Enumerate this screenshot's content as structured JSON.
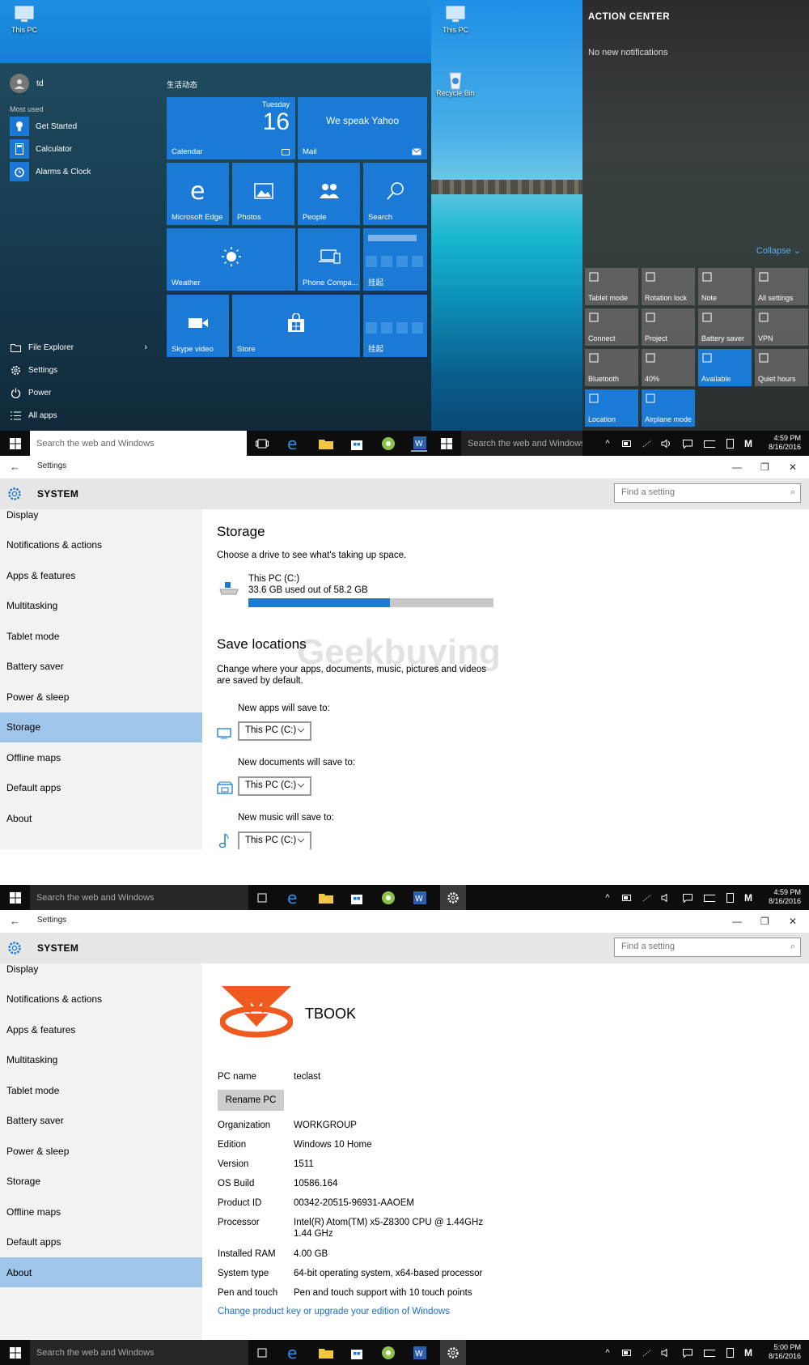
{
  "desktop": {
    "this_pc_label": "This PC",
    "recycle_bin_label": "Recycle Bin"
  },
  "start_menu": {
    "user": "td",
    "most_used_heading": "Most used",
    "most_used": [
      "Get Started",
      "Calculator",
      "Alarms & Clock"
    ],
    "footer": [
      "File Explorer",
      "Settings",
      "Power",
      "All apps"
    ],
    "tiles_heading": "生活动态",
    "calendar": {
      "day": "Tuesday",
      "date": "16",
      "label": "Calendar"
    },
    "mail": {
      "headline": "We speak Yahoo",
      "label": "Mail"
    },
    "tiles": {
      "edge": "Microsoft Edge",
      "photos": "Photos",
      "people": "People",
      "search": "Search",
      "weather": "Weather",
      "phone": "Phone Compa...",
      "hang1": "挂起",
      "skype": "Skype video",
      "store": "Store",
      "hang2": "挂起"
    }
  },
  "action_center": {
    "title": "ACTION CENTER",
    "no_notifications": "No new notifications",
    "collapse": "Collapse",
    "quick_actions": [
      {
        "label": "Tablet mode",
        "on": false
      },
      {
        "label": "Rotation lock",
        "on": false
      },
      {
        "label": "Note",
        "on": false
      },
      {
        "label": "All settings",
        "on": false
      },
      {
        "label": "Connect",
        "on": false
      },
      {
        "label": "Project",
        "on": false
      },
      {
        "label": "Battery saver",
        "on": false
      },
      {
        "label": "VPN",
        "on": false
      },
      {
        "label": "Bluetooth",
        "on": false
      },
      {
        "label": "40%",
        "on": false
      },
      {
        "label": "Available",
        "on": true
      },
      {
        "label": "Quiet hours",
        "on": false
      },
      {
        "label": "Location",
        "on": true
      },
      {
        "label": "Airplane mode",
        "on": true
      }
    ]
  },
  "taskbar1": {
    "search_left": "Search the web and Windows",
    "search_right": "Search the web and Windows",
    "time": "4:59 PM",
    "date": "8/16/2016"
  },
  "settings_common": {
    "window_title": "Settings",
    "section": "SYSTEM",
    "find_placeholder": "Find a setting",
    "nav": [
      "Display",
      "Notifications & actions",
      "Apps & features",
      "Multitasking",
      "Tablet mode",
      "Battery saver",
      "Power & sleep",
      "Storage",
      "Offline maps",
      "Default apps",
      "About"
    ]
  },
  "storage": {
    "heading": "Storage",
    "subtitle": "Choose a drive to see what's taking up space.",
    "drive_name": "This PC (C:)",
    "drive_usage": "33.6 GB used out of 58.2 GB",
    "used_gb": 33.6,
    "total_gb": 58.2,
    "save_heading": "Save locations",
    "save_desc_1": "Change where your apps, documents, music, pictures and videos",
    "save_desc_2": "are saved by default.",
    "apps_label": "New apps will save to:",
    "apps_value": "This PC (C:)",
    "docs_label": "New documents will save to:",
    "docs_value": "This PC (C:)",
    "music_label": "New music will save to:",
    "music_value": "This PC (C:)",
    "watermark": "Geekbuying"
  },
  "taskbar2": {
    "search": "Search the web and Windows",
    "time": "4:59 PM",
    "date": "8/16/2016"
  },
  "about": {
    "brand": "TBOOK",
    "pc_name_label": "PC name",
    "pc_name": "teclast",
    "rename_button": "Rename PC",
    "rows": [
      {
        "k": "Organization",
        "v": "WORKGROUP"
      },
      {
        "k": "Edition",
        "v": "Windows 10 Home"
      },
      {
        "k": "Version",
        "v": "1511"
      },
      {
        "k": "OS Build",
        "v": "10586.164"
      },
      {
        "k": "Product ID",
        "v": "00342-20515-96931-AAOEM"
      },
      {
        "k": "Processor",
        "v": "Intel(R) Atom(TM) x5-Z8300  CPU @ 1.44GHz"
      },
      {
        "k": "",
        "v": "1.44 GHz"
      },
      {
        "k": "Installed RAM",
        "v": "4.00 GB"
      },
      {
        "k": "System type",
        "v": "64-bit operating system, x64-based processor"
      },
      {
        "k": "Pen and touch",
        "v": "Pen and touch support with 10 touch points"
      }
    ],
    "link": "Change product key or upgrade your edition of Windows"
  },
  "taskbar3": {
    "search": "Search the web and Windows",
    "time": "5:00 PM",
    "date": "8/16/2016"
  },
  "colors": {
    "accent": "#1a7ad6",
    "selected_nav": "#9fc6ea",
    "tbook_orange": "#f05a1e",
    "link": "#1a6fc8"
  }
}
